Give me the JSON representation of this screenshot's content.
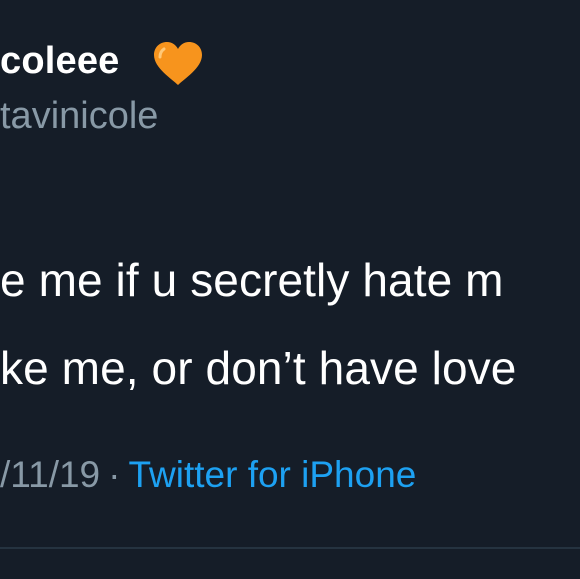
{
  "tweet": {
    "display_name": "coleee",
    "heart_icon": "orange-heart-icon",
    "heart_color": "#f7941d",
    "handle": "tavinicole",
    "text_lines": [
      "e me if u secretly hate m",
      "ke me, or don’t have love"
    ],
    "date": "/11/19",
    "separator": "·",
    "source": "Twitter for iPhone"
  },
  "colors": {
    "background": "#151d28",
    "primary_text": "#ffffff",
    "secondary_text": "#8899a6",
    "link": "#1da1f2",
    "divider": "#253340"
  }
}
